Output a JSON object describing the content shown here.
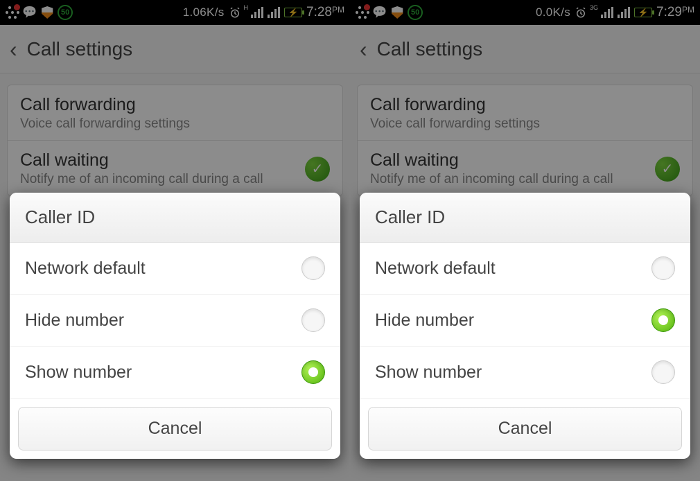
{
  "screens": [
    {
      "statusbar": {
        "speed": "1.06K/s",
        "circ": "50",
        "netlabel": "H",
        "time": "7:28",
        "ampm": "PM"
      },
      "header": {
        "title": "Call settings"
      },
      "settings": {
        "forwarding_title": "Call forwarding",
        "forwarding_sub": "Voice call forwarding settings",
        "waiting_title": "Call waiting",
        "waiting_sub": "Notify me of an incoming call during a call"
      },
      "dialog": {
        "title": "Caller ID",
        "opt0": "Network default",
        "opt1": "Hide number",
        "opt2": "Show number",
        "selected": 2,
        "cancel": "Cancel"
      }
    },
    {
      "statusbar": {
        "speed": "0.0K/s",
        "circ": "50",
        "netlabel": "3G",
        "time": "7:29",
        "ampm": "PM"
      },
      "header": {
        "title": "Call settings"
      },
      "settings": {
        "forwarding_title": "Call forwarding",
        "forwarding_sub": "Voice call forwarding settings",
        "waiting_title": "Call waiting",
        "waiting_sub": "Notify me of an incoming call during a call"
      },
      "dialog": {
        "title": "Caller ID",
        "opt0": "Network default",
        "opt1": "Hide number",
        "opt2": "Show number",
        "selected": 1,
        "cancel": "Cancel"
      }
    }
  ]
}
